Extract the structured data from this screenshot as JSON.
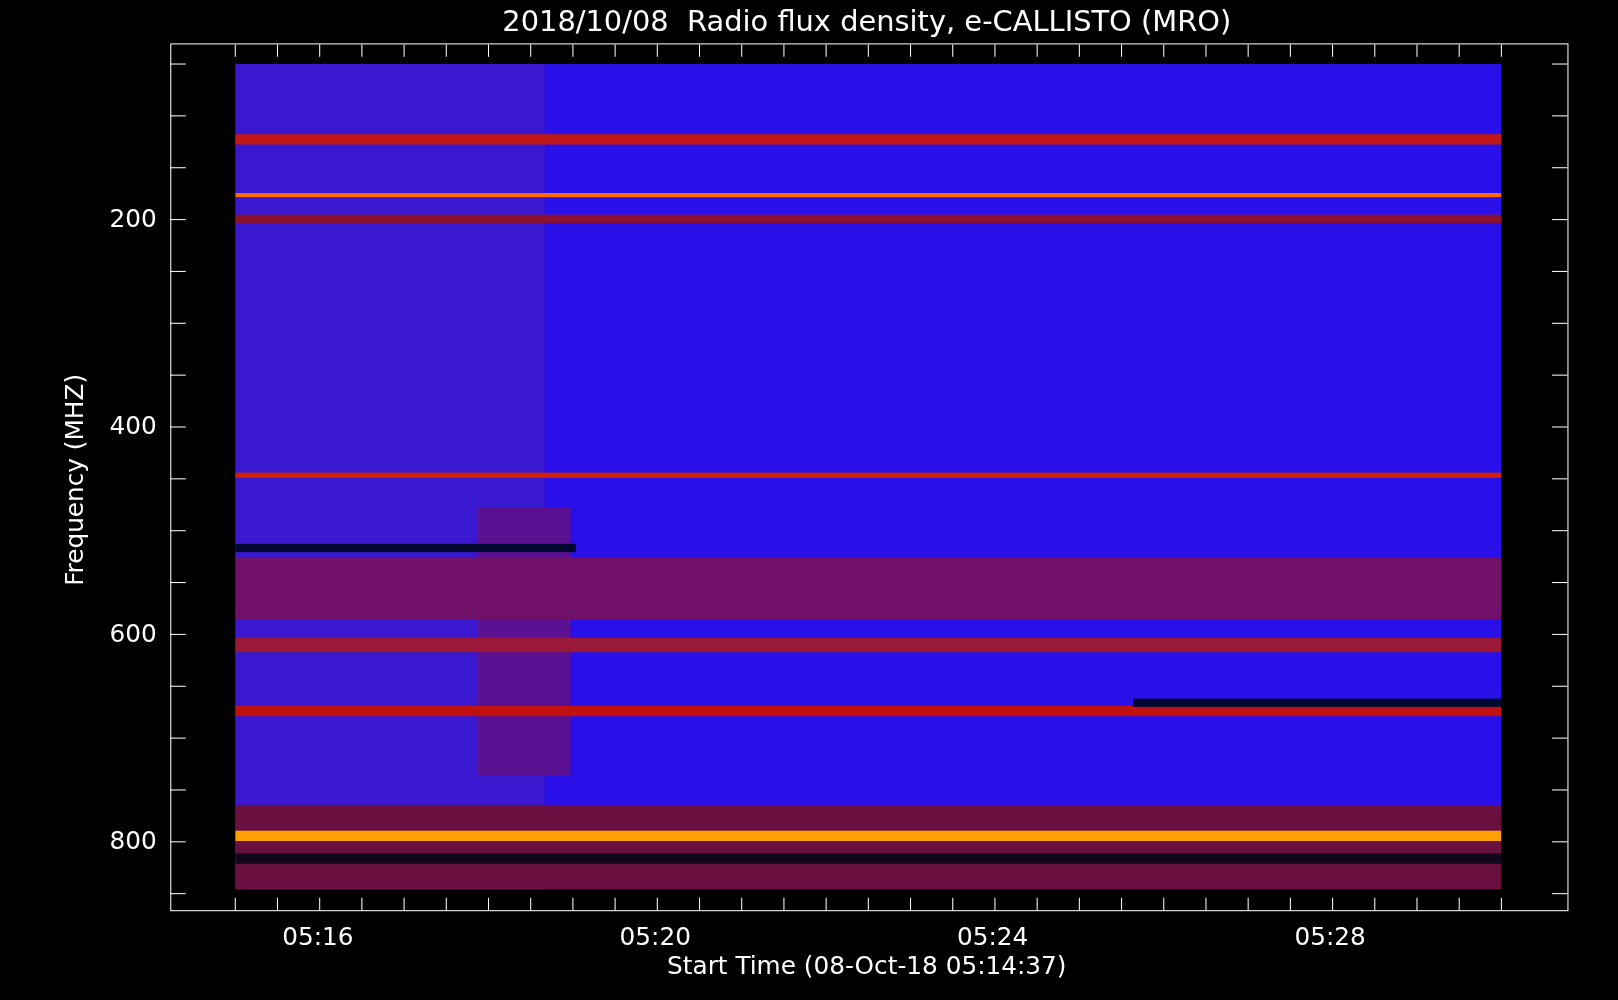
{
  "title": "2018/10/08  Radio flux density, e-CALLISTO (MRO)",
  "y_axis": {
    "label": "Frequency (MHZ)",
    "ticks": [
      "200",
      "400",
      "600",
      "800"
    ]
  },
  "x_axis": {
    "label": "Start Time (08-Oct-18 05:14:37)",
    "ticks": [
      "05:16",
      "05:20",
      "05:24",
      "05:28"
    ]
  }
}
